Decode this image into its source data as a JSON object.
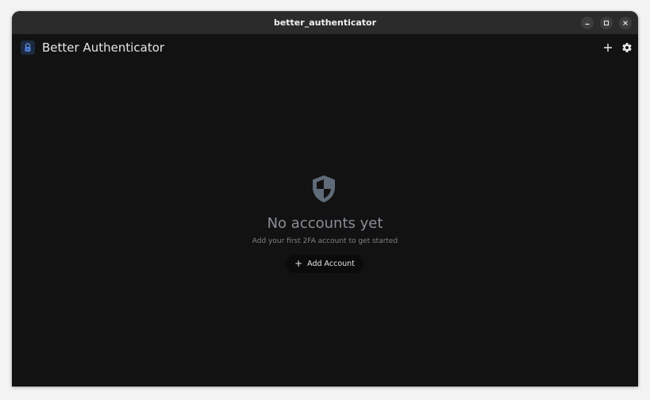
{
  "window": {
    "title": "better_authenticator",
    "controls": {
      "minimize_icon": "minimize-icon",
      "maximize_icon": "maximize-icon",
      "close_icon": "close-icon"
    }
  },
  "appbar": {
    "title": "Better Authenticator",
    "logo_icon": "lock-icon",
    "actions": [
      {
        "name": "add",
        "icon": "plus-icon"
      },
      {
        "name": "settings",
        "icon": "gear-icon"
      }
    ]
  },
  "empty_state": {
    "icon": "shield-icon",
    "title": "No accounts yet",
    "subtitle": "Add your first 2FA account to get started",
    "button": {
      "icon": "+",
      "label": "Add Account"
    }
  },
  "colors": {
    "window_bg": "#121212",
    "titlebar_bg": "#2b2b2b",
    "accent_blue": "#4a7fd6",
    "muted_text": "#8a8f96",
    "shield_gray": "#5f6b78"
  }
}
